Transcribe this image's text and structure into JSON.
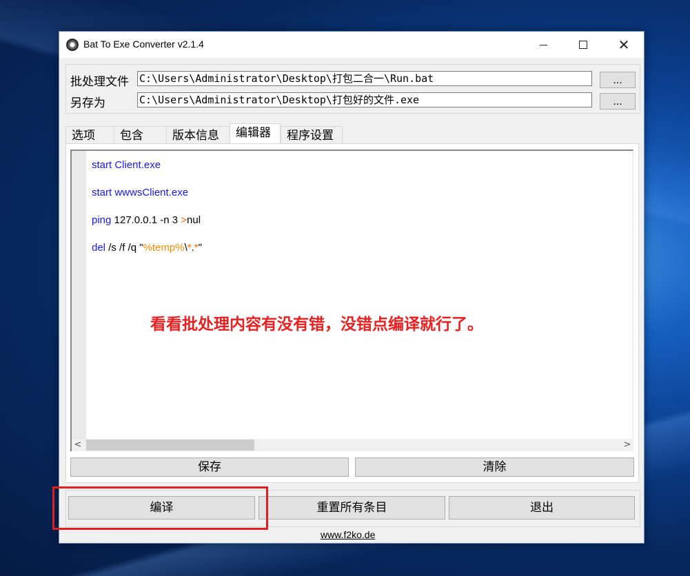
{
  "window": {
    "title": "Bat To Exe Converter v2.1.4",
    "controls": {
      "minimize": "minimize",
      "maximize": "maximize",
      "close": "✕"
    }
  },
  "paths": {
    "batch_label": "批处理文件",
    "batch_value": "C:\\Users\\Administrator\\Desktop\\打包二合一\\Run.bat",
    "saveas_label": "另存为",
    "saveas_value": "C:\\Users\\Administrator\\Desktop\\打包好的文件.exe",
    "browse_label": "..."
  },
  "tabs": [
    {
      "label": "选项"
    },
    {
      "label": "包含"
    },
    {
      "label": "版本信息"
    },
    {
      "label": "编辑器",
      "active": true
    },
    {
      "label": "程序设置"
    }
  ],
  "editor": {
    "lines": [
      {
        "parts": [
          {
            "t": "start Client.exe",
            "c": "kw"
          }
        ]
      },
      {
        "parts": [
          {
            "t": "start wwwsClient.exe",
            "c": "kw"
          }
        ]
      },
      {
        "parts": [
          {
            "t": "ping",
            "c": "kw"
          },
          {
            "t": " 127.0.0.1 -n 3 ",
            "c": ""
          },
          {
            "t": ">",
            "c": "op"
          },
          {
            "t": "nul",
            "c": ""
          }
        ]
      },
      {
        "parts": [
          {
            "t": "del",
            "c": "kw"
          },
          {
            "t": " /s /f /q \"",
            "c": ""
          },
          {
            "t": "%temp%",
            "c": "var"
          },
          {
            "t": "\\",
            "c": ""
          },
          {
            "t": "*",
            "c": "op"
          },
          {
            "t": ".",
            "c": ""
          },
          {
            "t": "*",
            "c": "op"
          },
          {
            "t": "\"",
            "c": ""
          }
        ]
      }
    ],
    "annotation": "看看批处理内容有没有错，没错点编译就行了。",
    "scroll_left": "<",
    "scroll_right": ">"
  },
  "panel_buttons": {
    "save": "保存",
    "clear": "清除"
  },
  "footer_buttons": {
    "compile": "编译",
    "reset": "重置所有条目",
    "exit": "退出"
  },
  "footer": {
    "site": "www.f2ko.de"
  },
  "colors": {
    "keyword": "#1818ff",
    "operator": "#ff6a00",
    "variable": "#ff8c00",
    "annotation": "#e8201f",
    "highlight": "#e02020"
  }
}
